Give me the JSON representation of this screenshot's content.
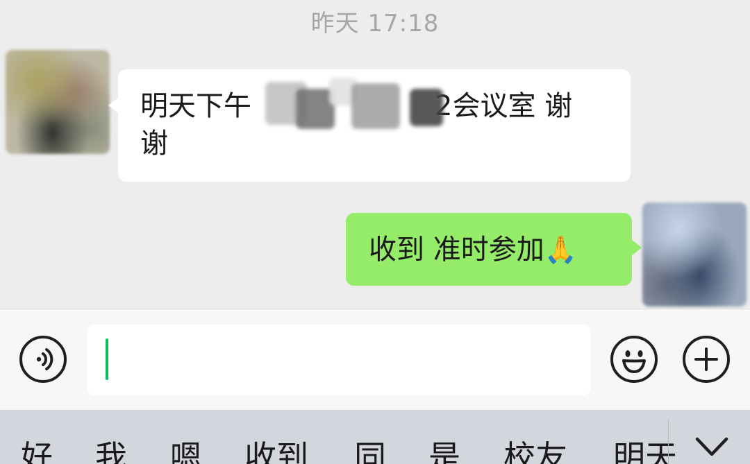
{
  "chat": {
    "timestamp": "昨天 17:18",
    "received_message": {
      "line1_start": "明天下午",
      "line1_end": "2会议室  谢",
      "line2": "谢"
    },
    "sent_message": {
      "text": "收到  准时参加",
      "emoji": "🙏"
    }
  },
  "input_bar": {
    "voice_icon": "voice-icon",
    "emoji_icon": "smiley-icon",
    "plus_icon": "plus-icon",
    "text_value": ""
  },
  "suggestions": {
    "items": [
      "好",
      "我",
      "嗯",
      "收到",
      "同",
      "是",
      "校友",
      "明天"
    ],
    "collapse_icon": "chevron-down-icon"
  },
  "colors": {
    "background": "#ededed",
    "sent_bubble": "#95ec69",
    "received_bubble": "#ffffff",
    "caret": "#07c160",
    "timestamp": "#a6a6a6"
  }
}
